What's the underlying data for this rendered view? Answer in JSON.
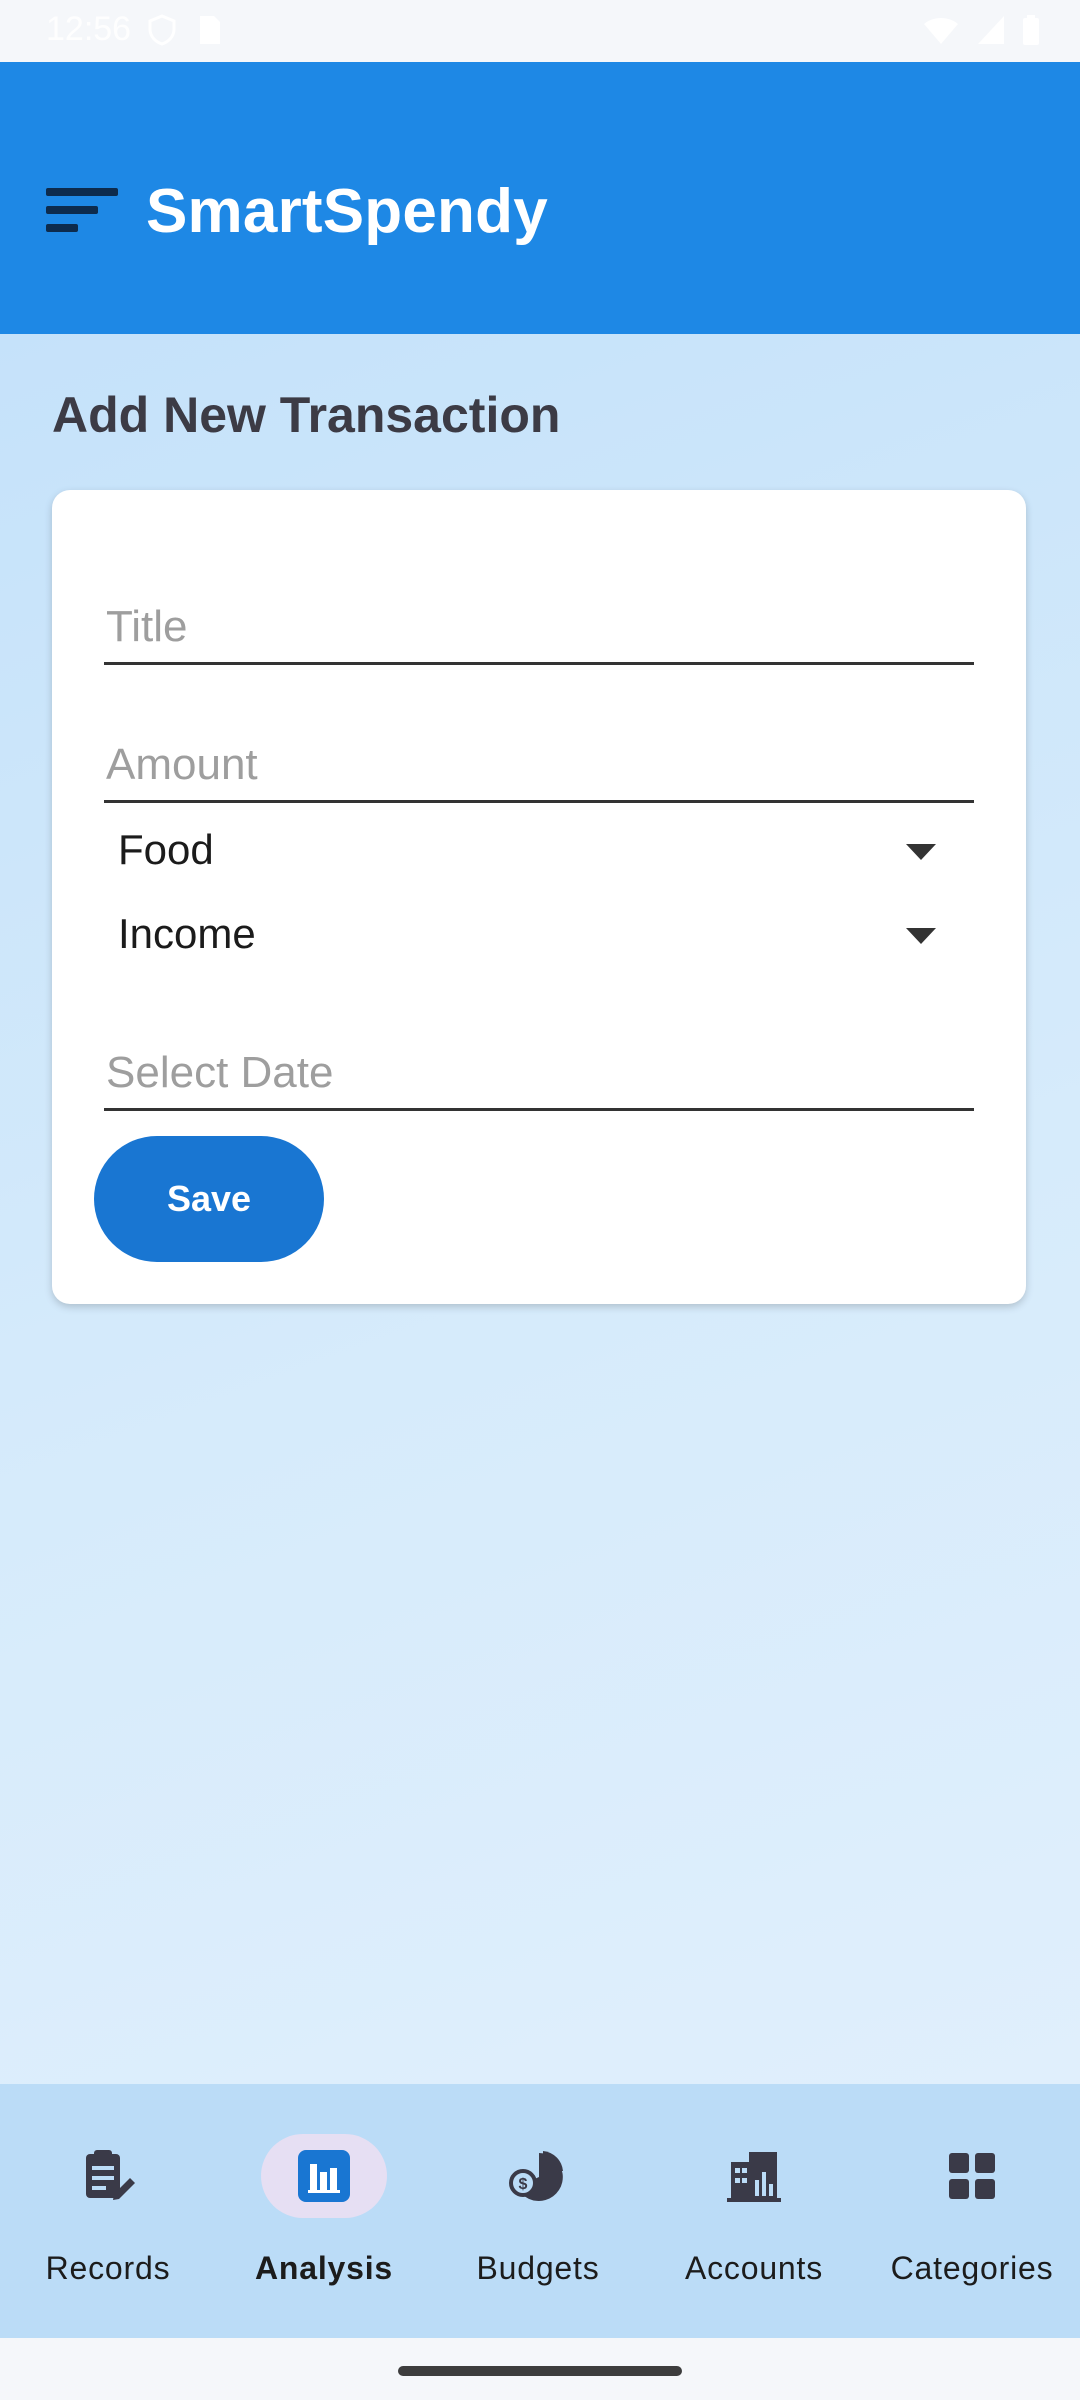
{
  "status_bar": {
    "time": "12:56"
  },
  "app_bar": {
    "title": "SmartSpendy",
    "menu_icon": "menu-sort-icon"
  },
  "page": {
    "title": "Add New Transaction"
  },
  "form": {
    "title_placeholder": "Title",
    "amount_placeholder": "Amount",
    "category_value": "Food",
    "type_value": "Income",
    "date_placeholder": "Select Date",
    "save_label": "Save"
  },
  "bottom_nav": {
    "items": [
      {
        "label": "Records",
        "icon": "clipboard-edit-icon"
      },
      {
        "label": "Analysis",
        "icon": "bar-chart-icon"
      },
      {
        "label": "Budgets",
        "icon": "pie-chart-coin-icon"
      },
      {
        "label": "Accounts",
        "icon": "calculator-building-icon"
      },
      {
        "label": "Categories",
        "icon": "grid-categories-icon"
      }
    ],
    "active_label": "Analysis"
  },
  "colors": {
    "primary": "#1e88e5",
    "button": "#1976d2",
    "nav_background": "#bbdcf7",
    "active_pill": "#e6dff3"
  }
}
